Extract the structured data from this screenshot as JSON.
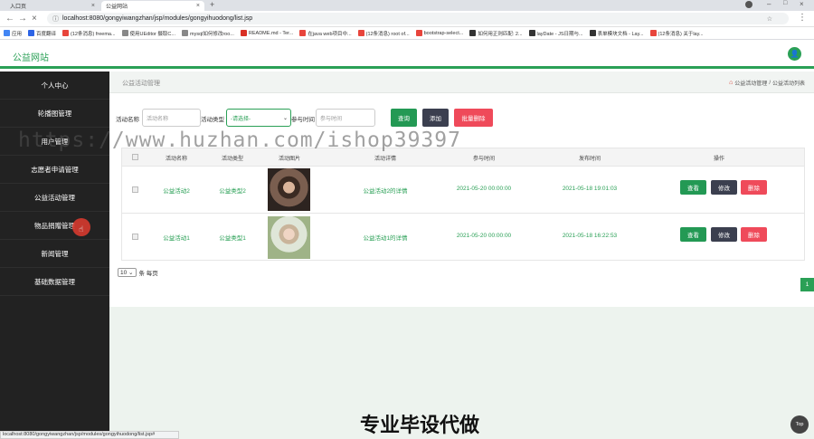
{
  "browser": {
    "tabs": [
      {
        "label": "入口页"
      },
      {
        "label": "公益网站"
      }
    ],
    "url": "localhost:8080/gongyiwangzhan/jsp/modules/gongyihuodong/list.jsp",
    "bookmarks": [
      {
        "label": "应用",
        "color": "#4285f4"
      },
      {
        "label": "百度翻译",
        "color": "#2d64e6"
      },
      {
        "label": "(12条消息) freema...",
        "color": "#e8453c"
      },
      {
        "label": "使用UEditor 摄取C...",
        "color": "#888888"
      },
      {
        "label": "mysql如何修改roo...",
        "color": "#888888"
      },
      {
        "label": "README.md - Ter...",
        "color": "#d93025"
      },
      {
        "label": "在java web项目中...",
        "color": "#e8453c"
      },
      {
        "label": "(12条消息) root of...",
        "color": "#e8453c"
      },
      {
        "label": "bootstrap-select...",
        "color": "#e8453c"
      },
      {
        "label": "如何用正则匹配: 2...",
        "color": "#333333"
      },
      {
        "label": "layDate - JS日期与...",
        "color": "#333333"
      },
      {
        "label": "表单模块文档 - Lay...",
        "color": "#333333"
      },
      {
        "label": "(12条消息) 关于lay...",
        "color": "#e8453c"
      }
    ]
  },
  "app": {
    "brand": "公益网站",
    "accent": "#2aa056"
  },
  "sidebar": {
    "items": [
      {
        "label": "个人中心"
      },
      {
        "label": "轮播图管理"
      },
      {
        "label": "用户管理"
      },
      {
        "label": "志愿者申请管理"
      },
      {
        "label": "公益活动管理"
      },
      {
        "label": "物品捐赠管理"
      },
      {
        "label": "新闻管理"
      },
      {
        "label": "基础数据管理"
      }
    ]
  },
  "page": {
    "title": "公益活动管理",
    "breadcrumb": [
      "公益活动管理",
      "/",
      "公益活动列表"
    ]
  },
  "filters": {
    "name_label": "活动名称",
    "name_placeholder": "活动名称",
    "type_label": "活动类型",
    "type_value": "-请选择-",
    "time_label": "参与时间",
    "time_placeholder": "参与时间",
    "search_btn": "查询",
    "add_btn": "添加",
    "batch_delete_btn": "批量删除"
  },
  "table": {
    "headers": [
      "活动名称",
      "活动类型",
      "活动图片",
      "活动详情",
      "参与时间",
      "发布时间",
      "操作"
    ],
    "rows": [
      {
        "name": "公益活动2",
        "type": "公益类型2",
        "detail": "公益活动2的详情",
        "join_time": "2021-05-20 00:00:00",
        "pub_time": "2021-05-18 19:01:03"
      },
      {
        "name": "公益活动1",
        "type": "公益类型1",
        "detail": "公益活动1的详情",
        "join_time": "2021-05-20 00:00:00",
        "pub_time": "2021-05-18 16:22:53"
      }
    ],
    "actions": {
      "view": "查看",
      "edit": "修改",
      "delete": "删除"
    }
  },
  "pagination": {
    "page_size": "10",
    "per_page_label": "条 每页",
    "current_page": "1"
  },
  "overlay": {
    "watermark": "https://www.huzhan.com/ishop39397",
    "bottom_text": "专业毕设代做",
    "status_url": "localhost:8080/gongyiwangzhan/jsp/modules/gongyihuodong/list.jsp#",
    "top_btn": "Top"
  }
}
